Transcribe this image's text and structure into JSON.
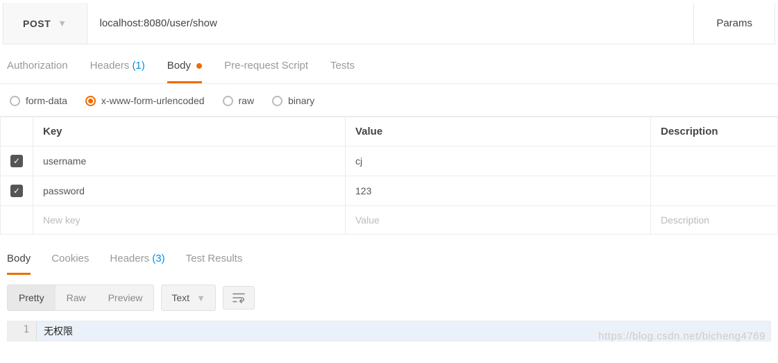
{
  "request": {
    "method": "POST",
    "url": "localhost:8080/user/show",
    "params_btn": "Params"
  },
  "tabs": {
    "authorization": "Authorization",
    "headers": "Headers",
    "headers_count": "(1)",
    "body": "Body",
    "prereq": "Pre-request Script",
    "tests": "Tests"
  },
  "body_types": {
    "form_data": "form-data",
    "urlencoded": "x-www-form-urlencoded",
    "raw": "raw",
    "binary": "binary"
  },
  "kv": {
    "header_key": "Key",
    "header_value": "Value",
    "header_desc": "Description",
    "rows": [
      {
        "key": "username",
        "value": "cj"
      },
      {
        "key": "password",
        "value": "123"
      }
    ],
    "new_key": "New key",
    "new_value": "Value",
    "new_desc": "Description"
  },
  "resp_tabs": {
    "body": "Body",
    "cookies": "Cookies",
    "headers": "Headers",
    "headers_count": "(3)",
    "tests": "Test Results"
  },
  "toolbar": {
    "pretty": "Pretty",
    "raw": "Raw",
    "preview": "Preview",
    "format": "Text"
  },
  "response": {
    "lines": [
      "无权限"
    ]
  },
  "watermark": "https://blog.csdn.net/bicheng4769"
}
